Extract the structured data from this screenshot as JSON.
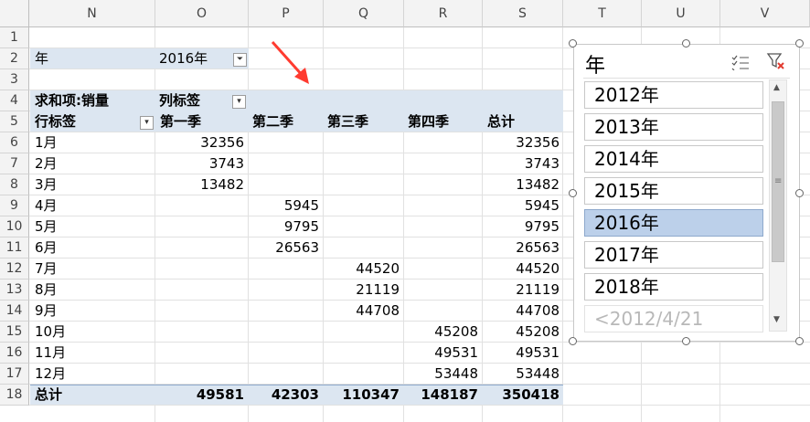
{
  "columns": [
    "N",
    "O",
    "P",
    "Q",
    "R",
    "S",
    "T",
    "U",
    "V"
  ],
  "rows": [
    "1",
    "2",
    "3",
    "4",
    "5",
    "6",
    "7",
    "8",
    "9",
    "10",
    "11",
    "12",
    "13",
    "14",
    "15",
    "16",
    "17",
    "18"
  ],
  "filter": {
    "label": "年",
    "value": "2016年"
  },
  "pivot": {
    "value_header": "求和项:销量",
    "col_label": "列标签",
    "row_label": "行标签",
    "quarters": [
      "第一季",
      "第二季",
      "第三季",
      "第四季"
    ],
    "total_header": "总计",
    "months": [
      {
        "m": "1月",
        "q": [
          "32356",
          "",
          "",
          ""
        ],
        "t": "32356"
      },
      {
        "m": "2月",
        "q": [
          "3743",
          "",
          "",
          ""
        ],
        "t": "3743"
      },
      {
        "m": "3月",
        "q": [
          "13482",
          "",
          "",
          ""
        ],
        "t": "13482"
      },
      {
        "m": "4月",
        "q": [
          "",
          "5945",
          "",
          ""
        ],
        "t": "5945"
      },
      {
        "m": "5月",
        "q": [
          "",
          "9795",
          "",
          ""
        ],
        "t": "9795"
      },
      {
        "m": "6月",
        "q": [
          "",
          "26563",
          "",
          ""
        ],
        "t": "26563"
      },
      {
        "m": "7月",
        "q": [
          "",
          "",
          "44520",
          ""
        ],
        "t": "44520"
      },
      {
        "m": "8月",
        "q": [
          "",
          "",
          "21119",
          ""
        ],
        "t": "21119"
      },
      {
        "m": "9月",
        "q": [
          "",
          "",
          "44708",
          ""
        ],
        "t": "44708"
      },
      {
        "m": "10月",
        "q": [
          "",
          "",
          "",
          "45208"
        ],
        "t": "45208"
      },
      {
        "m": "11月",
        "q": [
          "",
          "",
          "",
          "49531"
        ],
        "t": "49531"
      },
      {
        "m": "12月",
        "q": [
          "",
          "",
          "",
          "53448"
        ],
        "t": "53448"
      }
    ],
    "grand_label": "总计",
    "grand": [
      "49581",
      "42303",
      "110347",
      "148187",
      "350418"
    ]
  },
  "slicer": {
    "title": "年",
    "items": [
      "2012年",
      "2013年",
      "2014年",
      "2015年",
      "2016年",
      "2017年",
      "2018年",
      "<2012/4/21"
    ],
    "selected": "2016年"
  },
  "colors": {
    "band": "#dce6f1",
    "selected": "#bcd0ea",
    "arrow": "#ff3b30"
  }
}
